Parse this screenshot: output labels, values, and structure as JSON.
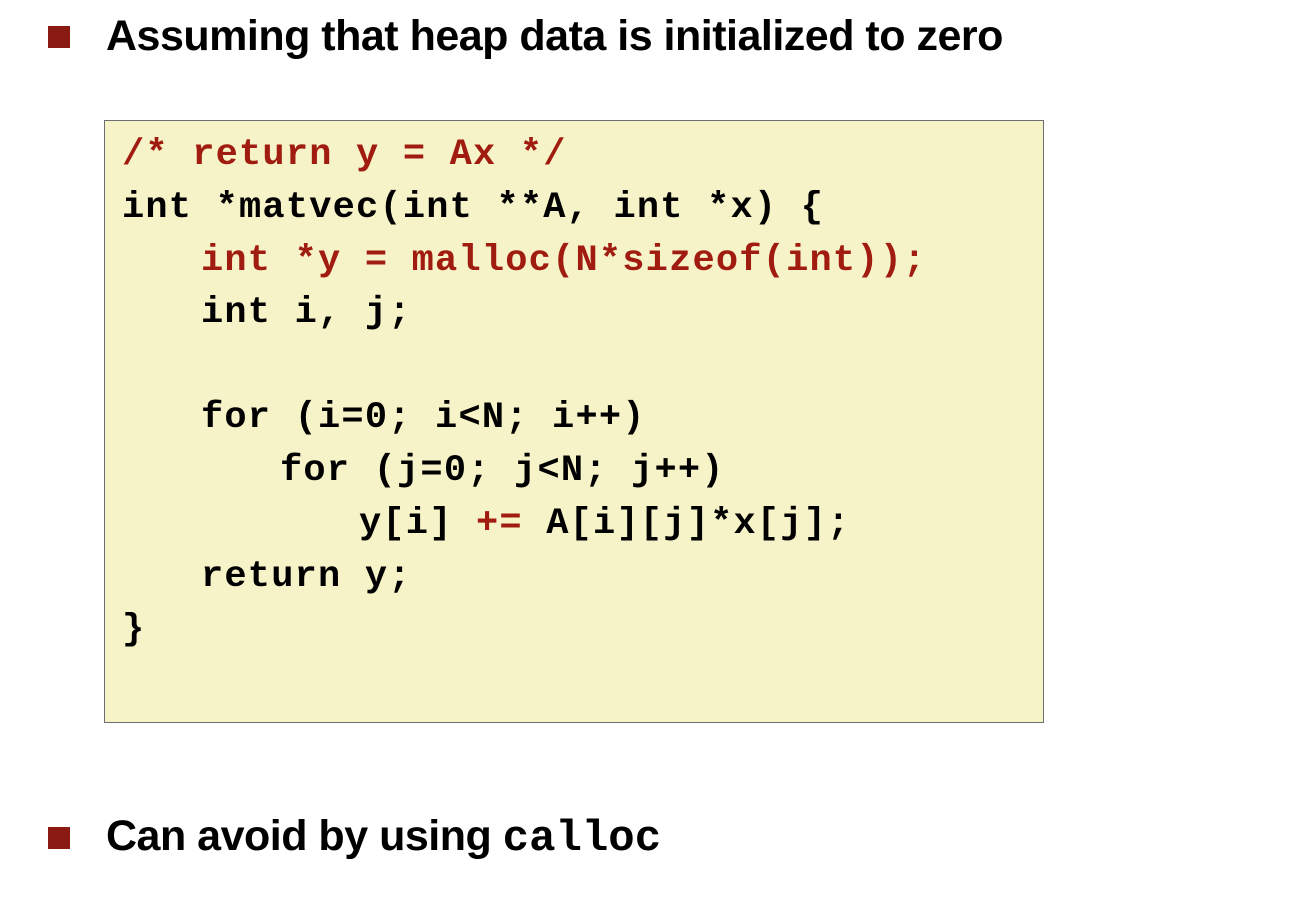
{
  "slide": {
    "bullet_1": "Assuming that heap data is initialized to zero",
    "bullet_2_prefix": "Can avoid by using ",
    "bullet_2_code": "calloc"
  },
  "colors": {
    "bullet": "#8b1a12",
    "highlight": "#a01c10",
    "code_background": "#f7f3c8"
  },
  "code": {
    "line_1": "/* return y = Ax */",
    "line_2": "int *matvec(int **A, int *x) {",
    "line_3": "int *y = malloc(N*sizeof(int));",
    "line_4": "int i, j;",
    "line_5": "for (i=0; i<N; i++)",
    "line_6": "for (j=0; j<N; j++)",
    "line_7_a": "y[i] ",
    "line_7_op": "+=",
    "line_7_b": " A[i][j]*x[j];",
    "line_8": "return y;",
    "line_9": "}"
  }
}
